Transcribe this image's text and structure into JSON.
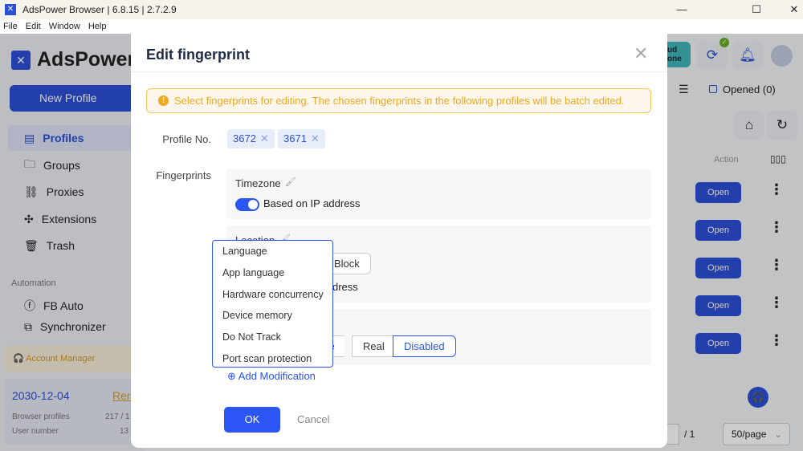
{
  "window": {
    "title": "AdsPower Browser | 6.8.15 | 2.7.2.9",
    "minimize": "—",
    "maximize": "☐",
    "close": "✕"
  },
  "menu": [
    "File",
    "Edit",
    "Window",
    "Help"
  ],
  "sidebar": {
    "brand": "AdsPower",
    "new_profile": "New Profile",
    "items": [
      {
        "label": "Profiles",
        "icon": "folder-icon",
        "active": true
      },
      {
        "label": "Groups",
        "icon": "folder-open-icon"
      },
      {
        "label": "Proxies",
        "icon": "proxy-icon"
      },
      {
        "label": "Extensions",
        "icon": "puzzle-icon"
      },
      {
        "label": "Trash",
        "icon": "trash-icon"
      }
    ],
    "automation_label": "Automation",
    "automation_items": [
      {
        "label": "FB Auto"
      },
      {
        "label": "Synchronizer"
      }
    ],
    "account_manager": "Account Manager",
    "plan": {
      "expiry": "2030-12-04",
      "renew": "Ren",
      "browser_profiles_label": "Browser profiles",
      "browser_profiles_value": "217 / 1",
      "user_number_label": "User number",
      "user_number_value": "13"
    }
  },
  "right": {
    "cloud_badge": "ud\none",
    "opened": "Opened (0)",
    "action_header": "Action",
    "open_label": "Open",
    "page_total": "/ 1",
    "page_size": "50/page"
  },
  "modal": {
    "title": "Edit fingerprint",
    "alert": "Select fingerprints for editing. The chosen fingerprints in the following profiles will be batch edited.",
    "profile_no_label": "Profile No.",
    "profiles": [
      "3672",
      "3671"
    ],
    "fingerprints_label": "Fingerprints",
    "timezone": {
      "title": "Timezone",
      "toggle_on": true,
      "toggle_label": "Based on IP address"
    },
    "location": {
      "title": "Location",
      "block_label": "Block",
      "partial_text": "dress"
    },
    "third": {
      "options": [
        "ce",
        "Real",
        "Disabled"
      ],
      "selected": "Disabled"
    },
    "dropdown": [
      "Language",
      "App language",
      "Hardware concurrency",
      "Device memory",
      "Do Not Track",
      "Port scan protection"
    ],
    "add_modification": "Add Modification",
    "ok": "OK",
    "cancel": "Cancel"
  },
  "colors": {
    "primary": "#2b55f5",
    "warning": "#f0a91f"
  }
}
